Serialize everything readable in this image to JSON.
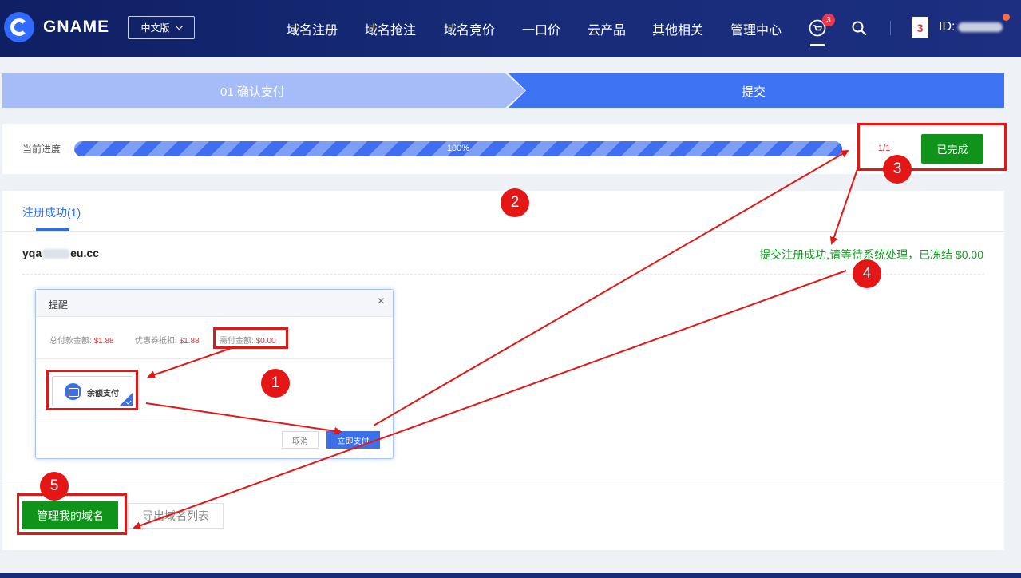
{
  "header": {
    "brand": "GNAME",
    "lang": "中文版",
    "nav": [
      "域名注册",
      "域名抢注",
      "域名竞价",
      "一口价",
      "云产品",
      "其他相关",
      "管理中心"
    ],
    "cart_count": "3",
    "card_label": "3",
    "user_id_prefix": "ID:"
  },
  "steps": {
    "step1": "01.确认支付",
    "step2": "提交"
  },
  "progress": {
    "label": "当前进度",
    "percent_text": "100%",
    "value": 100,
    "count": "1/1",
    "done_label": "已完成"
  },
  "result": {
    "tab_label": "注册成功",
    "tab_count": "(1)",
    "domain_prefix": "yqa",
    "domain_suffix": "eu.cc",
    "status": "提交注册成功,请等待系统处理，已冻结 $0.00"
  },
  "modal": {
    "title": "提醒",
    "close": "×",
    "total_label": "总付款金额:",
    "total_value": "$1.88",
    "coupon_label": "优惠券抵扣:",
    "coupon_value": "$1.88",
    "due_label": "需付金额:",
    "due_value": "$0.00",
    "pay_option": "余额支付",
    "cancel": "取消",
    "pay_now": "立即支付"
  },
  "actions": {
    "manage": "管理我的域名",
    "export": "导出域名列表"
  },
  "annotations": [
    "1",
    "2",
    "3",
    "4",
    "5"
  ],
  "colors": {
    "header": "#172b78",
    "primary": "#3e73f3",
    "success": "#10931a",
    "annotation": "#e51616"
  }
}
